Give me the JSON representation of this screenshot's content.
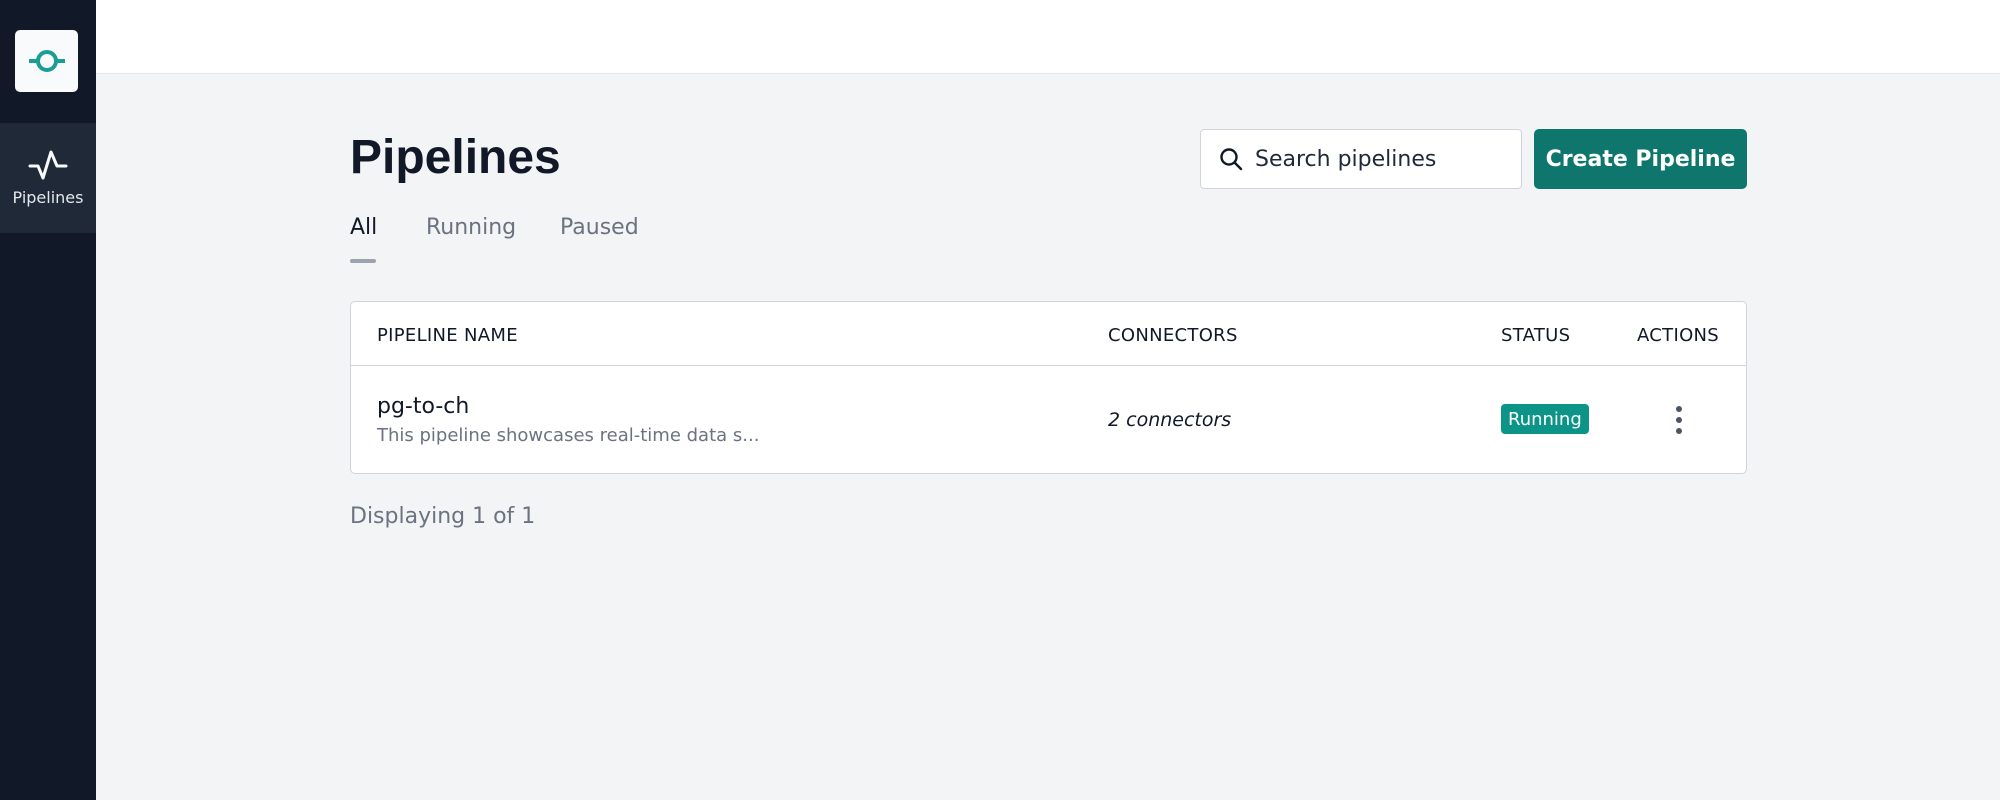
{
  "sidebar": {
    "logo_icon": "pipeline-logo-icon",
    "items": [
      {
        "label": "Pipelines",
        "icon": "activity-icon",
        "active": true
      }
    ]
  },
  "main": {
    "title": "Pipelines",
    "search": {
      "placeholder": "Search pipelines",
      "value": ""
    },
    "create_button": "Create Pipeline",
    "tabs": [
      {
        "label": "All",
        "active": true
      },
      {
        "label": "Running",
        "active": false
      },
      {
        "label": "Paused",
        "active": false
      }
    ],
    "table": {
      "columns": [
        "PIPELINE NAME",
        "CONNECTORS",
        "STATUS",
        "ACTIONS"
      ],
      "rows": [
        {
          "name": "pg-to-ch",
          "description": "This pipeline showcases real-time data s...",
          "connectors": "2 connectors",
          "status": "Running",
          "actions_icon": "more-vertical-icon"
        }
      ]
    },
    "footer_count": "Displaying 1 of 1"
  },
  "colors": {
    "sidebar_bg": "#111827",
    "sidebar_active_bg": "#1f2937",
    "accent": "#0f766e",
    "status_running": "#0d9488",
    "page_bg": "#f3f4f6"
  }
}
